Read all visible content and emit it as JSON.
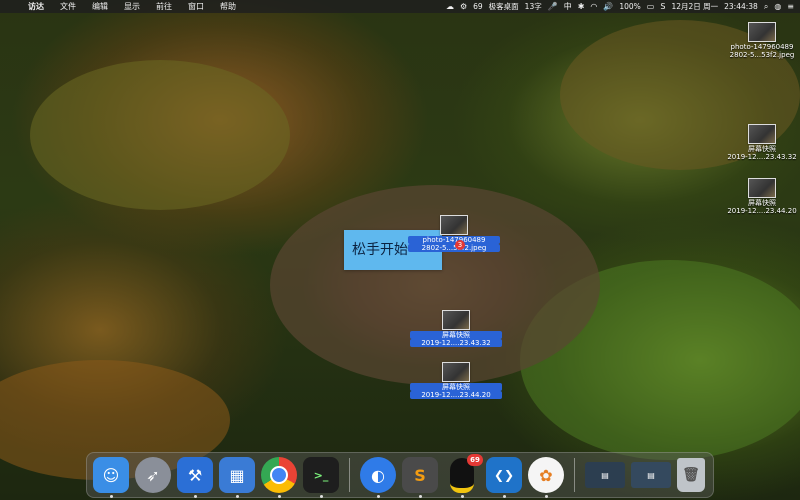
{
  "menubar": {
    "app_name": "访达",
    "menus": [
      "文件",
      "编辑",
      "显示",
      "前往",
      "窗口",
      "帮助"
    ],
    "status": {
      "count": "69",
      "ext_app": "极客桌面",
      "typing": "13字",
      "battery": "100%",
      "date": "12月2日 周一",
      "time": "23:44:38"
    }
  },
  "desktop": {
    "files": [
      {
        "name_line1": "photo-14796048​9",
        "name_line2": "2802-5...53f2.jpeg"
      },
      {
        "name_line1": "屏幕快照",
        "name_line2": "2019-12....23.43.32"
      },
      {
        "name_line1": "屏幕快照",
        "name_line2": "2019-12....23.44.20"
      }
    ],
    "dragging": {
      "tooltip": "松手开始",
      "count": "3",
      "items": [
        {
          "name_line1": "photo-147960489",
          "name_line2": "2802-5...53f2.jpeg"
        },
        {
          "name_line1": "屏幕快照",
          "name_line2": "2019-12....23.43.32"
        },
        {
          "name_line1": "屏幕快照",
          "name_line2": "2019-12....23.44.20"
        }
      ]
    }
  },
  "dock": {
    "apps": [
      {
        "name": "finder",
        "icon": "finder-icon",
        "color": "#3a8ee6",
        "glyph": "☺"
      },
      {
        "name": "launchpad",
        "icon": "rocket-icon",
        "color": "#8a8f99",
        "glyph": "🚀"
      },
      {
        "name": "xcode-tools",
        "icon": "hammer-icon",
        "color": "#2b6fd6",
        "glyph": "⚒"
      },
      {
        "name": "simulator",
        "icon": "device-icon",
        "color": "#3a7bd5",
        "glyph": "▦"
      },
      {
        "name": "chrome",
        "icon": "chrome-icon",
        "color": "#34a853",
        "glyph": "◉"
      },
      {
        "name": "terminal",
        "icon": "terminal-icon",
        "color": "#1e1e1e",
        "glyph": ">_"
      },
      {
        "name": "baidu-pan",
        "icon": "cloud-icon",
        "color": "#2f7be8",
        "glyph": "⬤"
      },
      {
        "name": "sublime",
        "icon": "sublime-icon",
        "color": "#4a4a4a",
        "glyph": "S"
      },
      {
        "name": "qq",
        "icon": "penguin-icon",
        "color": "#111111",
        "glyph": "🐧",
        "badge": "69"
      },
      {
        "name": "vscode",
        "icon": "vscode-icon",
        "color": "#1f73c9",
        "glyph": "❮❯"
      },
      {
        "name": "photos",
        "icon": "photos-icon",
        "color": "#f5f5f5",
        "glyph": "✿"
      }
    ],
    "minimized": [
      {
        "name": "window-1",
        "icon": "window-thumb-icon"
      },
      {
        "name": "window-2",
        "icon": "window-thumb-icon"
      }
    ],
    "trash": {
      "name": "trash",
      "icon": "trash-icon"
    }
  },
  "colors": {
    "selection": "#2a63d6",
    "tooltip_bg": "#5fb8ee",
    "badge": "#e53935"
  }
}
